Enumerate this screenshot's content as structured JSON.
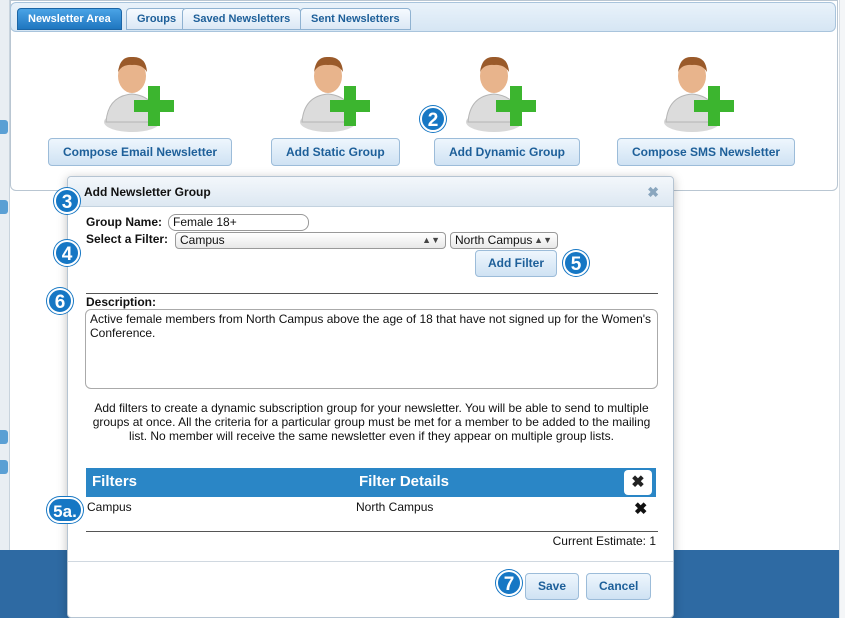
{
  "tabs": [
    {
      "label": "Newsletter Area",
      "active": true
    },
    {
      "label": "Groups",
      "active": false
    },
    {
      "label": "Saved Newsletters",
      "active": false
    },
    {
      "label": "Sent Newsletters",
      "active": false
    }
  ],
  "actions": [
    {
      "label": "Compose Email Newsletter",
      "icon": "add-user-icon"
    },
    {
      "label": "Add Static Group",
      "icon": "add-user-icon"
    },
    {
      "label": "Add Dynamic Group",
      "icon": "add-user-icon"
    },
    {
      "label": "Compose SMS Newsletter",
      "icon": "add-user-icon"
    }
  ],
  "callouts": {
    "c2": "2",
    "c3": "3",
    "c4": "4",
    "c5": "5",
    "c5a": "5a.",
    "c6": "6",
    "c7": "7"
  },
  "modal": {
    "title": "Add Newsletter Group",
    "close_icon": "close-icon",
    "group_name_label": "Group Name:",
    "group_name_value": "Female 18+",
    "filter_label": "Select a Filter:",
    "filter_field": "Campus",
    "filter_value": "North Campus",
    "add_filter_label": "Add Filter",
    "description_label": "Description:",
    "description_value": "Active female members from North Campus above the age of 18 that have not signed up for the Women's Conference.",
    "help_text": "Add filters to create a dynamic subscription group for your newsletter. You will be able to send to multiple groups at once. All the criteria for a particular group must be met for a member to be added to the mailing list. No member will receive the same newsletter even if they appear on multiple group lists.",
    "grid": {
      "columns": [
        "Filters",
        "Filter Details"
      ],
      "rows": [
        {
          "filter": "Campus",
          "details": "North Campus"
        }
      ]
    },
    "estimate": "Current Estimate: 1",
    "save_label": "Save",
    "cancel_label": "Cancel"
  },
  "colors": {
    "accent": "#1677c4",
    "grid_header": "#2a86c6",
    "icon_green": "#3cb52f",
    "bottom_band": "#2e6aa3"
  }
}
